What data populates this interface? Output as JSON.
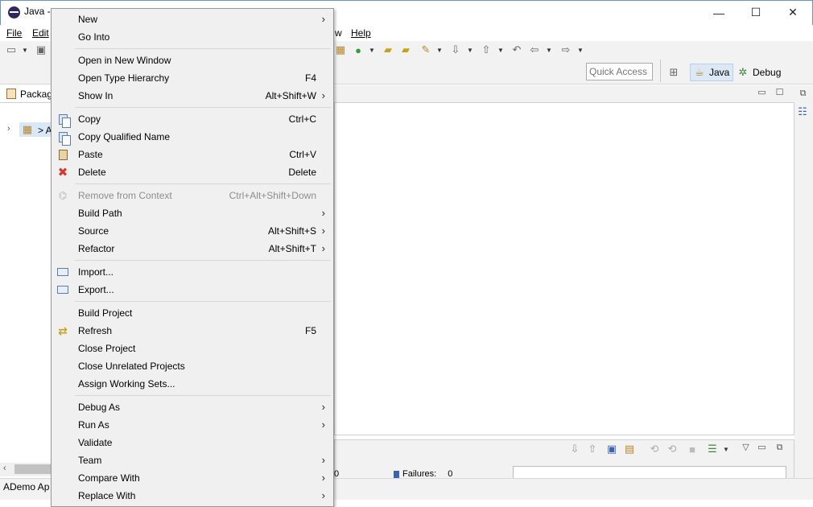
{
  "window": {
    "title": "Java -",
    "controls": {
      "minimize": "—",
      "maximize": "☐",
      "close": "✕"
    }
  },
  "menubar": {
    "file": "File",
    "edit": "Edit",
    "window_tail": "w",
    "help": "Help"
  },
  "toolbar": {
    "quick_access_placeholder": "Quick Access",
    "perspectives": [
      {
        "label": "Java",
        "icon": "java-perspective-icon",
        "selected": true
      },
      {
        "label": "Debug",
        "icon": "debug-perspective-icon",
        "selected": false
      }
    ]
  },
  "package_explorer": {
    "tab_label": "Packag",
    "tree_label": "> A",
    "status_text": "ADemo Ap"
  },
  "junit": {
    "runs_fragment": "0",
    "failures_label": "Failures:",
    "failures_value": "0"
  },
  "context_menu": {
    "items": [
      {
        "label": "New",
        "shortcut": "",
        "submenu": true,
        "icon": ""
      },
      {
        "label": "Go Into",
        "shortcut": "",
        "submenu": false,
        "icon": ""
      },
      {
        "label": "Open in New Window",
        "shortcut": "",
        "submenu": false,
        "icon": ""
      },
      {
        "label": "Open Type Hierarchy",
        "shortcut": "F4",
        "submenu": false,
        "icon": ""
      },
      {
        "label": "Show In",
        "shortcut": "Alt+Shift+W",
        "submenu": true,
        "icon": ""
      },
      {
        "label": "Copy",
        "shortcut": "Ctrl+C",
        "submenu": false,
        "icon": "copy-icon"
      },
      {
        "label": "Copy Qualified Name",
        "shortcut": "",
        "submenu": false,
        "icon": "copy-qualified-name-icon"
      },
      {
        "label": "Paste",
        "shortcut": "Ctrl+V",
        "submenu": false,
        "icon": "paste-icon"
      },
      {
        "label": "Delete",
        "shortcut": "Delete",
        "submenu": false,
        "icon": "delete-icon"
      },
      {
        "label": "Remove from Context",
        "shortcut": "Ctrl+Alt+Shift+Down",
        "submenu": false,
        "icon": "remove-context-icon",
        "disabled": true
      },
      {
        "label": "Build Path",
        "shortcut": "",
        "submenu": true,
        "icon": ""
      },
      {
        "label": "Source",
        "shortcut": "Alt+Shift+S",
        "submenu": true,
        "icon": ""
      },
      {
        "label": "Refactor",
        "shortcut": "Alt+Shift+T",
        "submenu": true,
        "icon": ""
      },
      {
        "label": "Import...",
        "shortcut": "",
        "submenu": false,
        "icon": "import-icon"
      },
      {
        "label": "Export...",
        "shortcut": "",
        "submenu": false,
        "icon": "export-icon"
      },
      {
        "label": "Build Project",
        "shortcut": "",
        "submenu": false,
        "icon": ""
      },
      {
        "label": "Refresh",
        "shortcut": "F5",
        "submenu": false,
        "icon": "refresh-icon"
      },
      {
        "label": "Close Project",
        "shortcut": "",
        "submenu": false,
        "icon": ""
      },
      {
        "label": "Close Unrelated Projects",
        "shortcut": "",
        "submenu": false,
        "icon": ""
      },
      {
        "label": "Assign Working Sets...",
        "shortcut": "",
        "submenu": false,
        "icon": ""
      },
      {
        "label": "Debug As",
        "shortcut": "",
        "submenu": true,
        "icon": ""
      },
      {
        "label": "Run As",
        "shortcut": "",
        "submenu": true,
        "icon": ""
      },
      {
        "label": "Validate",
        "shortcut": "",
        "submenu": false,
        "icon": ""
      },
      {
        "label": "Team",
        "shortcut": "",
        "submenu": true,
        "icon": ""
      },
      {
        "label": "Compare With",
        "shortcut": "",
        "submenu": true,
        "icon": ""
      },
      {
        "label": "Replace With",
        "shortcut": "",
        "submenu": true,
        "icon": ""
      }
    ],
    "submenu_glyph": "›"
  }
}
